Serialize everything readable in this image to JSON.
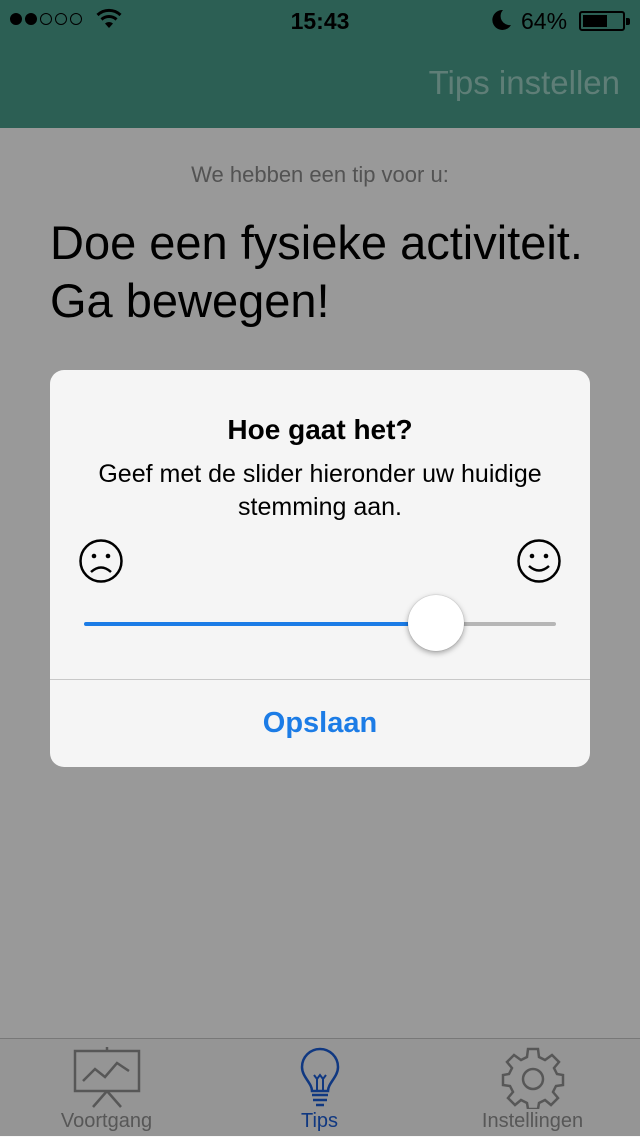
{
  "status_bar": {
    "time": "15:43",
    "battery": "64%",
    "battery_level": 0.64,
    "signal_bars_filled": 2,
    "signal_bars_total": 5
  },
  "nav": {
    "title": "Tips instellen"
  },
  "content": {
    "subtitle": "We hebben een tip voor u:",
    "tip": "Doe een fysieke activiteit. Ga bewegen!"
  },
  "alert": {
    "title": "Hoe gaat het?",
    "message": "Geef met de slider hieronder uw huidige stemming aan.",
    "slider_value": 0.78,
    "button": "Opslaan"
  },
  "tabs": [
    {
      "label": "Voortgang",
      "icon": "chart-board-icon",
      "active": false
    },
    {
      "label": "Tips",
      "icon": "lightbulb-icon",
      "active": true
    },
    {
      "label": "Instellingen",
      "icon": "gear-icon",
      "active": false
    }
  ],
  "colors": {
    "nav_bar": "#4a9e8c",
    "accent": "#1c7ce6",
    "tab_active": "#1c5ed8"
  }
}
